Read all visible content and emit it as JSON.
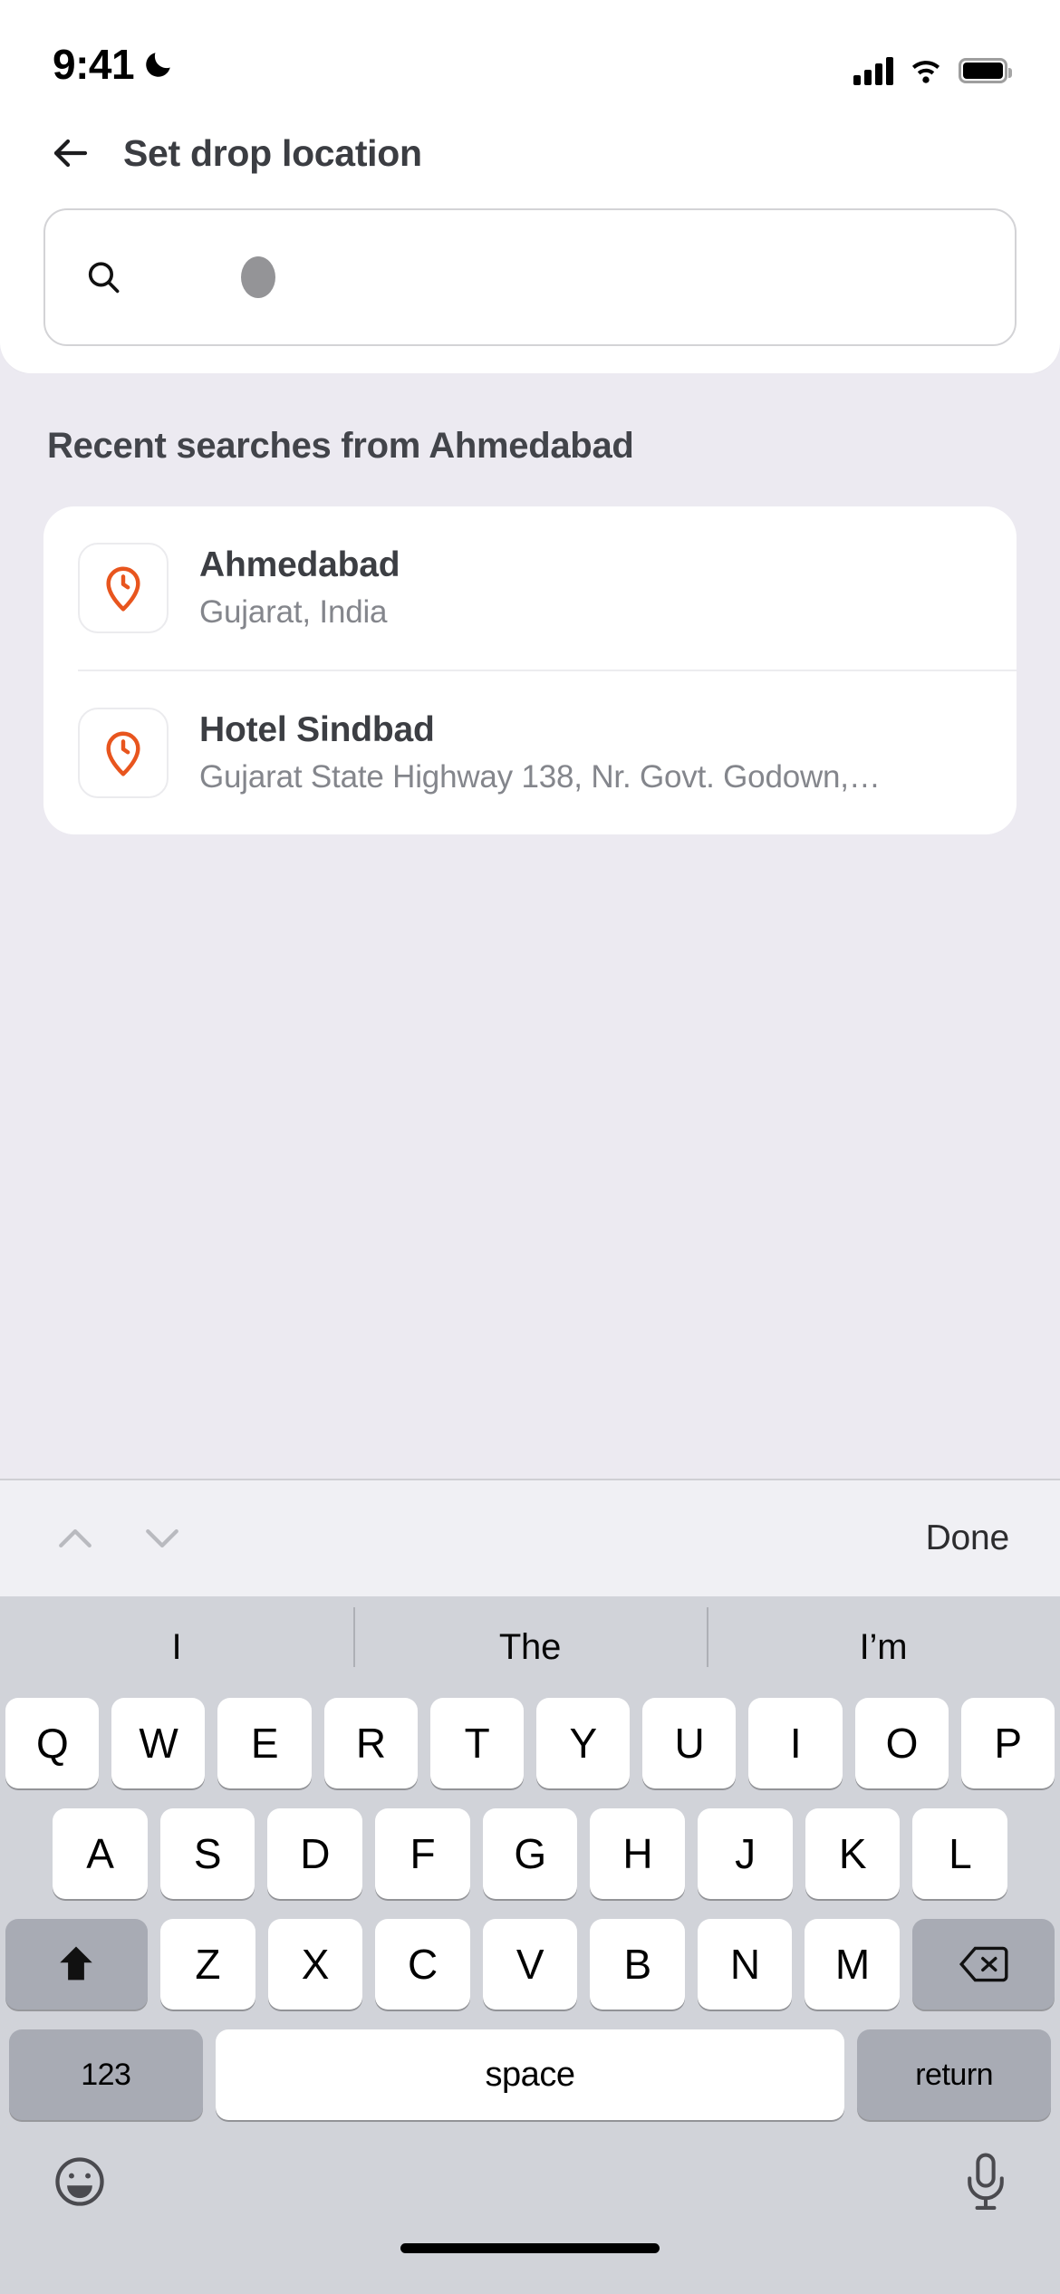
{
  "status_bar": {
    "time": "9:41",
    "dnd_icon": "moon-icon",
    "signal_icon": "cellular-signal-icon",
    "wifi_icon": "wifi-icon",
    "battery_icon": "battery-icon"
  },
  "header": {
    "back_icon": "back-arrow-icon",
    "title": "Set drop location"
  },
  "search": {
    "icon": "search-icon",
    "value": "",
    "placeholder": "",
    "cursor_indicator": "loading-dot"
  },
  "recent": {
    "section_title": "Recent searches from Ahmedabad",
    "items": [
      {
        "icon": "recent-location-pin-icon",
        "title": "Ahmedabad",
        "subtitle": "Gujarat, India"
      },
      {
        "icon": "recent-location-pin-icon",
        "title": "Hotel Sindbad",
        "subtitle": "Gujarat State Highway 138, Nr. Govt. Godown,…"
      }
    ]
  },
  "accessory_bar": {
    "prev_icon": "chevron-up-icon",
    "next_icon": "chevron-down-icon",
    "done_label": "Done"
  },
  "keyboard": {
    "suggestions": [
      "I",
      "The",
      "I’m"
    ],
    "row1": [
      "Q",
      "W",
      "E",
      "R",
      "T",
      "Y",
      "U",
      "I",
      "O",
      "P"
    ],
    "row2": [
      "A",
      "S",
      "D",
      "F",
      "G",
      "H",
      "J",
      "K",
      "L"
    ],
    "row3": [
      "Z",
      "X",
      "C",
      "V",
      "B",
      "N",
      "M"
    ],
    "shift_icon": "shift-icon",
    "backspace_icon": "backspace-icon",
    "numbers_label": "123",
    "space_label": "space",
    "return_label": "return",
    "emoji_icon": "emoji-smiley-icon",
    "mic_icon": "microphone-icon"
  },
  "colors": {
    "accent": "#e8551e",
    "background": "#eceaf1",
    "keyboard_bg": "#d1d3d9",
    "key_dark": "#a8abb4",
    "title": "#3b3d42",
    "subtitle": "#84868c"
  }
}
